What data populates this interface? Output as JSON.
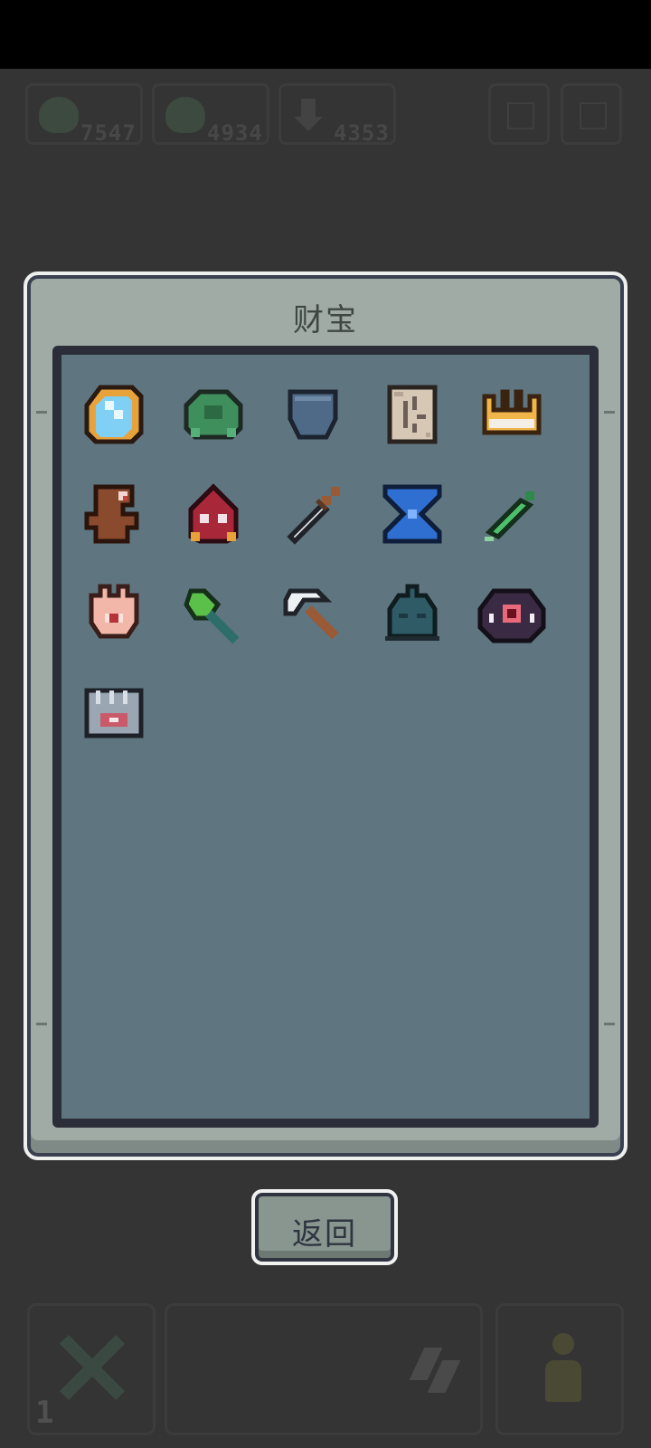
{
  "hud": {
    "resources": [
      {
        "icon": "green-slime-icon",
        "value": "7547"
      },
      {
        "icon": "green-slime-icon",
        "value": "4934"
      },
      {
        "icon": "download-arrow-icon",
        "value": "4353"
      }
    ]
  },
  "bottom_bar": {
    "count": "1"
  },
  "dialog": {
    "title": "财宝",
    "back_label": "返回",
    "treasures": [
      {
        "icon": "magic-mirror-icon"
      },
      {
        "icon": "turtle-shell-icon"
      },
      {
        "icon": "pocket-icon"
      },
      {
        "icon": "ancient-scroll-icon"
      },
      {
        "icon": "golden-crown-icon"
      },
      {
        "icon": "wooden-idol-icon"
      },
      {
        "icon": "red-hood-mask-icon"
      },
      {
        "icon": "dagger-icon"
      },
      {
        "icon": "hourglass-icon"
      },
      {
        "icon": "green-sword-icon"
      },
      {
        "icon": "eye-palm-icon"
      },
      {
        "icon": "green-axe-icon"
      },
      {
        "icon": "scythe-icon"
      },
      {
        "icon": "bell-icon"
      },
      {
        "icon": "demon-eye-icon"
      },
      {
        "icon": "metal-chest-icon"
      }
    ]
  },
  "colors": {
    "background": "#343434",
    "panel": "#a1aba6",
    "inner_panel": "#5f7580",
    "frame_dark": "#2b2e38"
  }
}
